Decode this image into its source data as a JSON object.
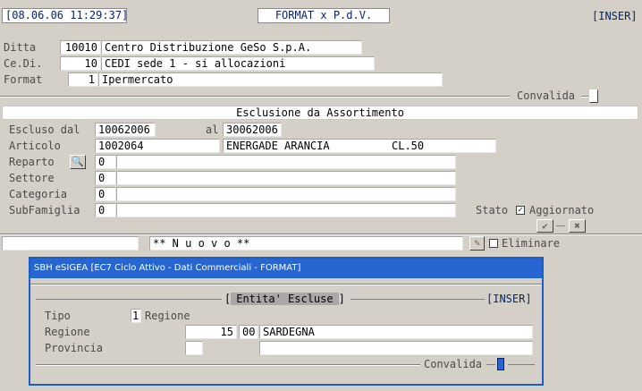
{
  "topbar": {
    "datetime": "08.06.06 11:29:37",
    "title": "FORMAT x P.d.V.",
    "mode": "INSER"
  },
  "header": {
    "ditta_label": "Ditta",
    "ditta_code": "10010",
    "ditta_name": "Centro Distribuzione GeSo S.p.A.",
    "cedi_label": "Ce.Di.",
    "cedi_code": "10",
    "cedi_name": "CEDI sede 1 - si allocazioni",
    "format_label": "Format",
    "format_code": "1",
    "format_name": "Ipermercato",
    "convalida_label": "Convalida"
  },
  "section": {
    "title": "Esclusione da Assortimento",
    "escluso_dal_label": "Escluso dal",
    "escluso_dal_value": "10062006",
    "al_label": "al",
    "al_value": "30062006",
    "articolo_label": "Articolo",
    "articolo_code": "1002064",
    "articolo_desc": "ENERGADE ARANCIA",
    "articolo_size": "CL.50",
    "reparto_label": "Reparto",
    "reparto_code": "0",
    "settore_label": "Settore",
    "settore_code": "0",
    "categoria_label": "Categoria",
    "categoria_code": "0",
    "subfamiglia_label": "SubFamiglia",
    "subfamiglia_code": "0",
    "stato_label": "Stato",
    "stato_value": "Aggiornato",
    "stato_checked": true
  },
  "bottom": {
    "status_text": "** N u o v o **",
    "eliminare_label": "Eliminare"
  },
  "dialog": {
    "title": "SBH eSIGEA [EC7 Ciclo Attivo - Dati Commerciali - FORMAT]",
    "subtitle": "Entita' Escluse",
    "mode": "INSER",
    "tipo_label": "Tipo",
    "tipo_code": "1",
    "tipo_value": "Regione",
    "regione_label": "Regione",
    "regione_num1": "15",
    "regione_num2": "00",
    "regione_name": "SARDEGNA",
    "provincia_label": "Provincia",
    "convalida_label": "Convalida"
  },
  "colors": {
    "background": "#d4d0c8",
    "dialog_title": "#2765d0",
    "text_blue": "#0a246a"
  }
}
